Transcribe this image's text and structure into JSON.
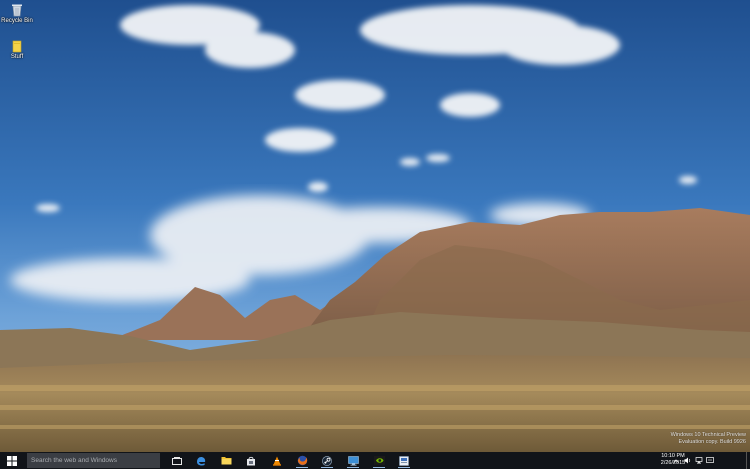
{
  "desktop": {
    "wallpaper": "desert mountain landscape under blue sky",
    "icons": [
      {
        "label": "Recycle Bin",
        "icon": "recycle-bin-icon"
      },
      {
        "label": "Stuff",
        "icon": "folder-icon"
      }
    ],
    "watermark": {
      "line1": "Windows 10 Technical Preview",
      "line2": "Evaluation copy. Build 9926"
    }
  },
  "taskbar": {
    "search_placeholder": "Search the web and Windows",
    "pinned": [
      {
        "icon": "task-view-icon"
      },
      {
        "icon": "edge-icon"
      },
      {
        "icon": "file-explorer-icon"
      },
      {
        "icon": "store-icon"
      },
      {
        "icon": "vlc-icon"
      },
      {
        "icon": "firefox-icon"
      },
      {
        "icon": "steam-icon"
      },
      {
        "icon": "remote-desktop-icon"
      },
      {
        "icon": "nvidia-icon"
      },
      {
        "icon": "app-icon"
      }
    ],
    "tray": [
      "chevron-up-icon",
      "volume-icon",
      "network-icon",
      "input-icon"
    ],
    "time": "10:10 PM",
    "date": "2/26/2015",
    "colors": {
      "taskbar": "#111419",
      "accent": "#8fb4dc"
    }
  }
}
